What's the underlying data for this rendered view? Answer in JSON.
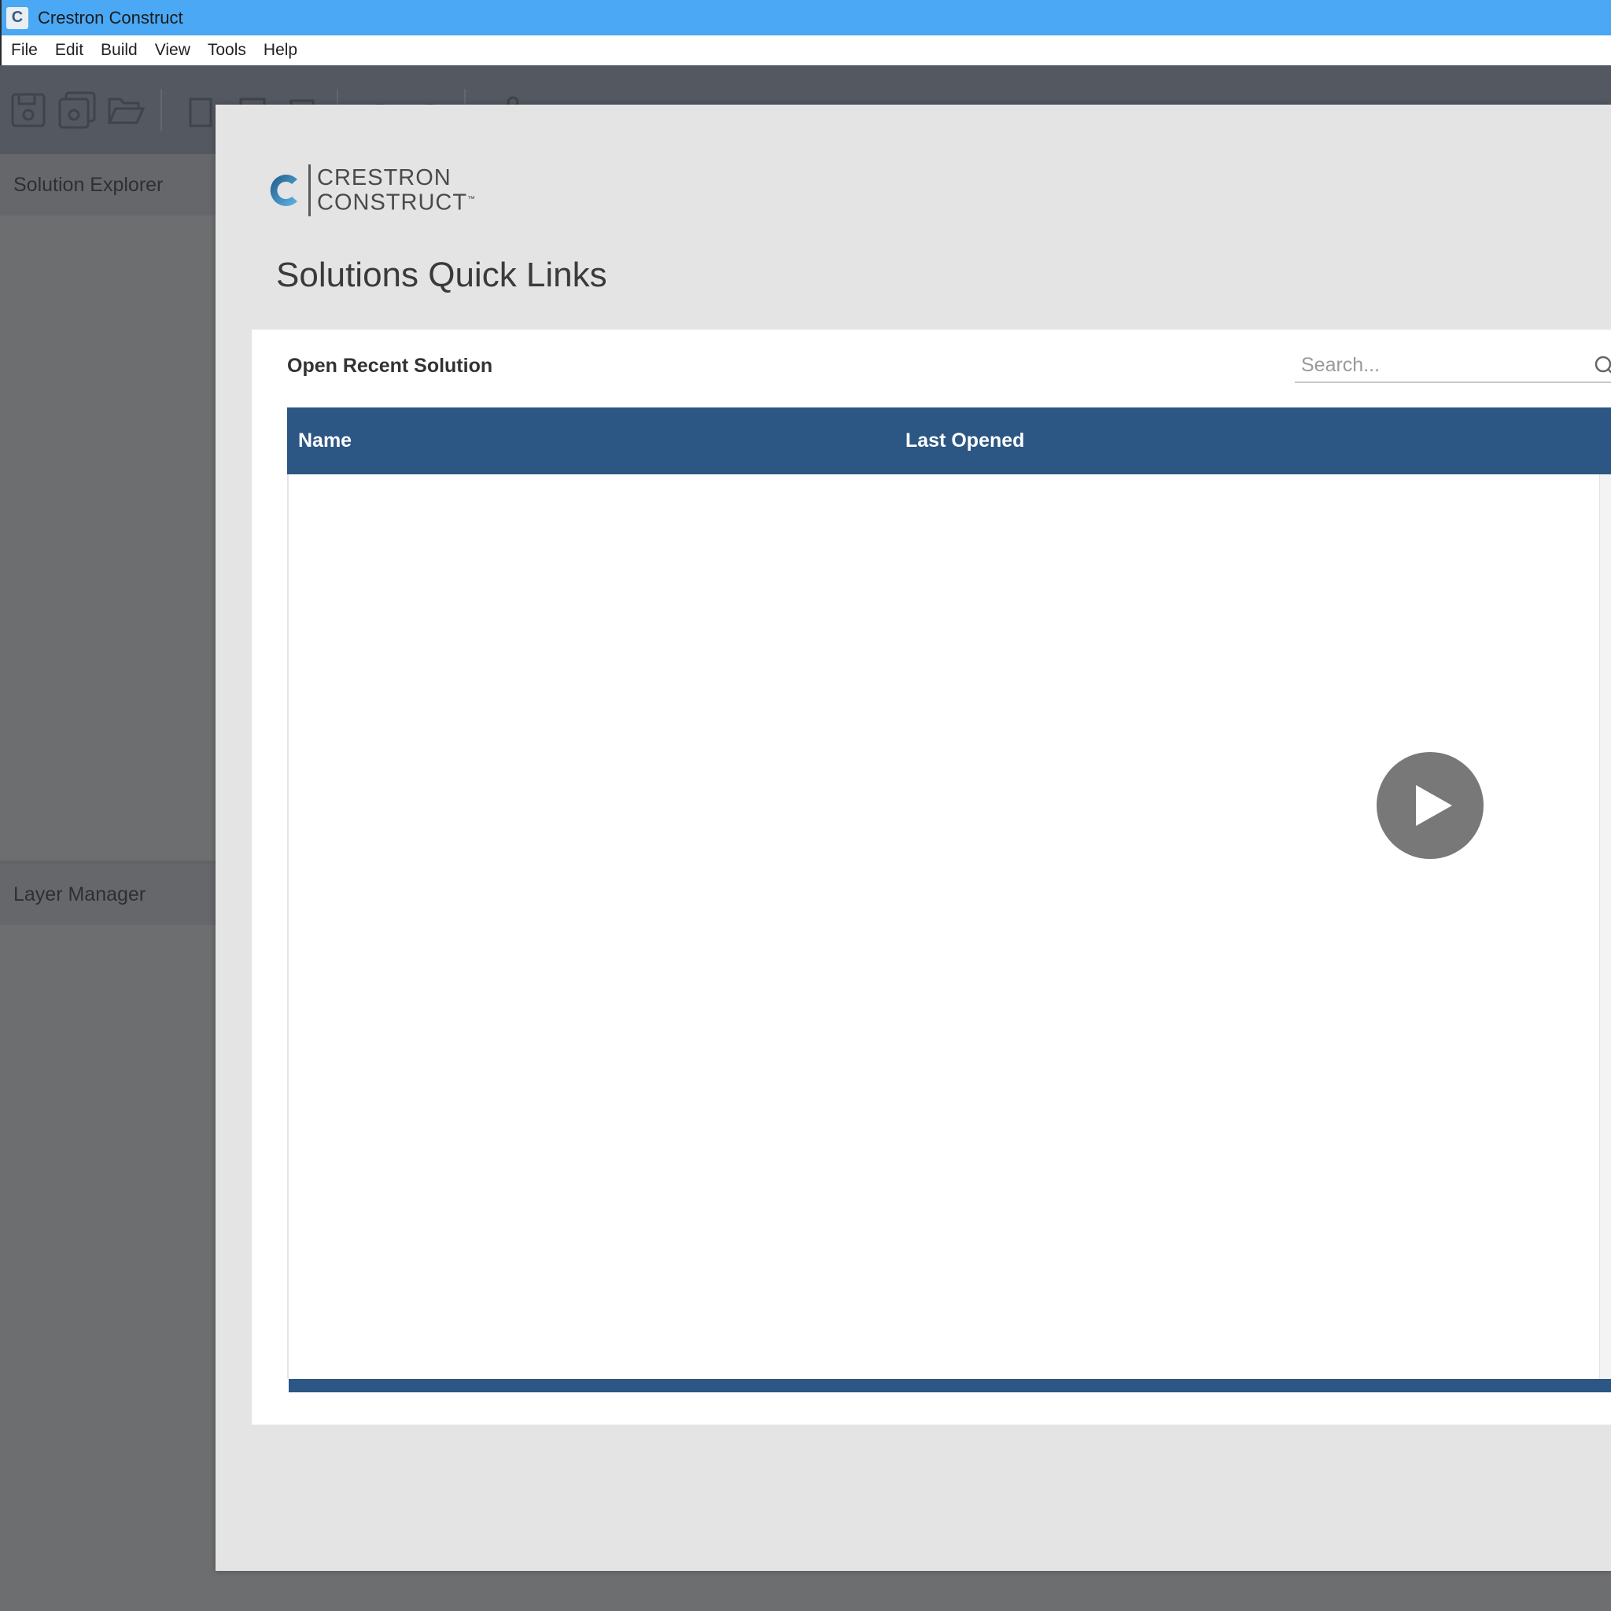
{
  "window": {
    "title": "Crestron Construct",
    "app_icon_glyph": "C"
  },
  "menu": {
    "items": [
      "File",
      "Edit",
      "Build",
      "View",
      "Tools",
      "Help"
    ]
  },
  "toolbar": {
    "icons": [
      "save-icon",
      "save-all-icon",
      "open-folder-icon",
      "copy-icon",
      "paste-icon",
      "clipboard-icon",
      "undo-icon",
      "redo-icon",
      "pin-icon"
    ]
  },
  "panels": {
    "solution_explorer": "Solution Explorer",
    "layer_manager": "Layer Manager"
  },
  "dialog": {
    "logo_line1": "CRESTRON",
    "logo_line2": "CONSTRUCT",
    "logo_tm": "™",
    "title": "Solutions Quick Links",
    "recent": {
      "title": "Open Recent Solution",
      "search_placeholder": "Search...",
      "columns": [
        "Name",
        "Last Opened"
      ],
      "rows": []
    }
  },
  "colors": {
    "titlebar": "#4aa8f4",
    "table_header": "#2c5684",
    "overlay": "#6d6e70",
    "dialog_bg": "#e4e4e4"
  },
  "icons": {
    "play": "play-icon",
    "search": "search-icon"
  }
}
